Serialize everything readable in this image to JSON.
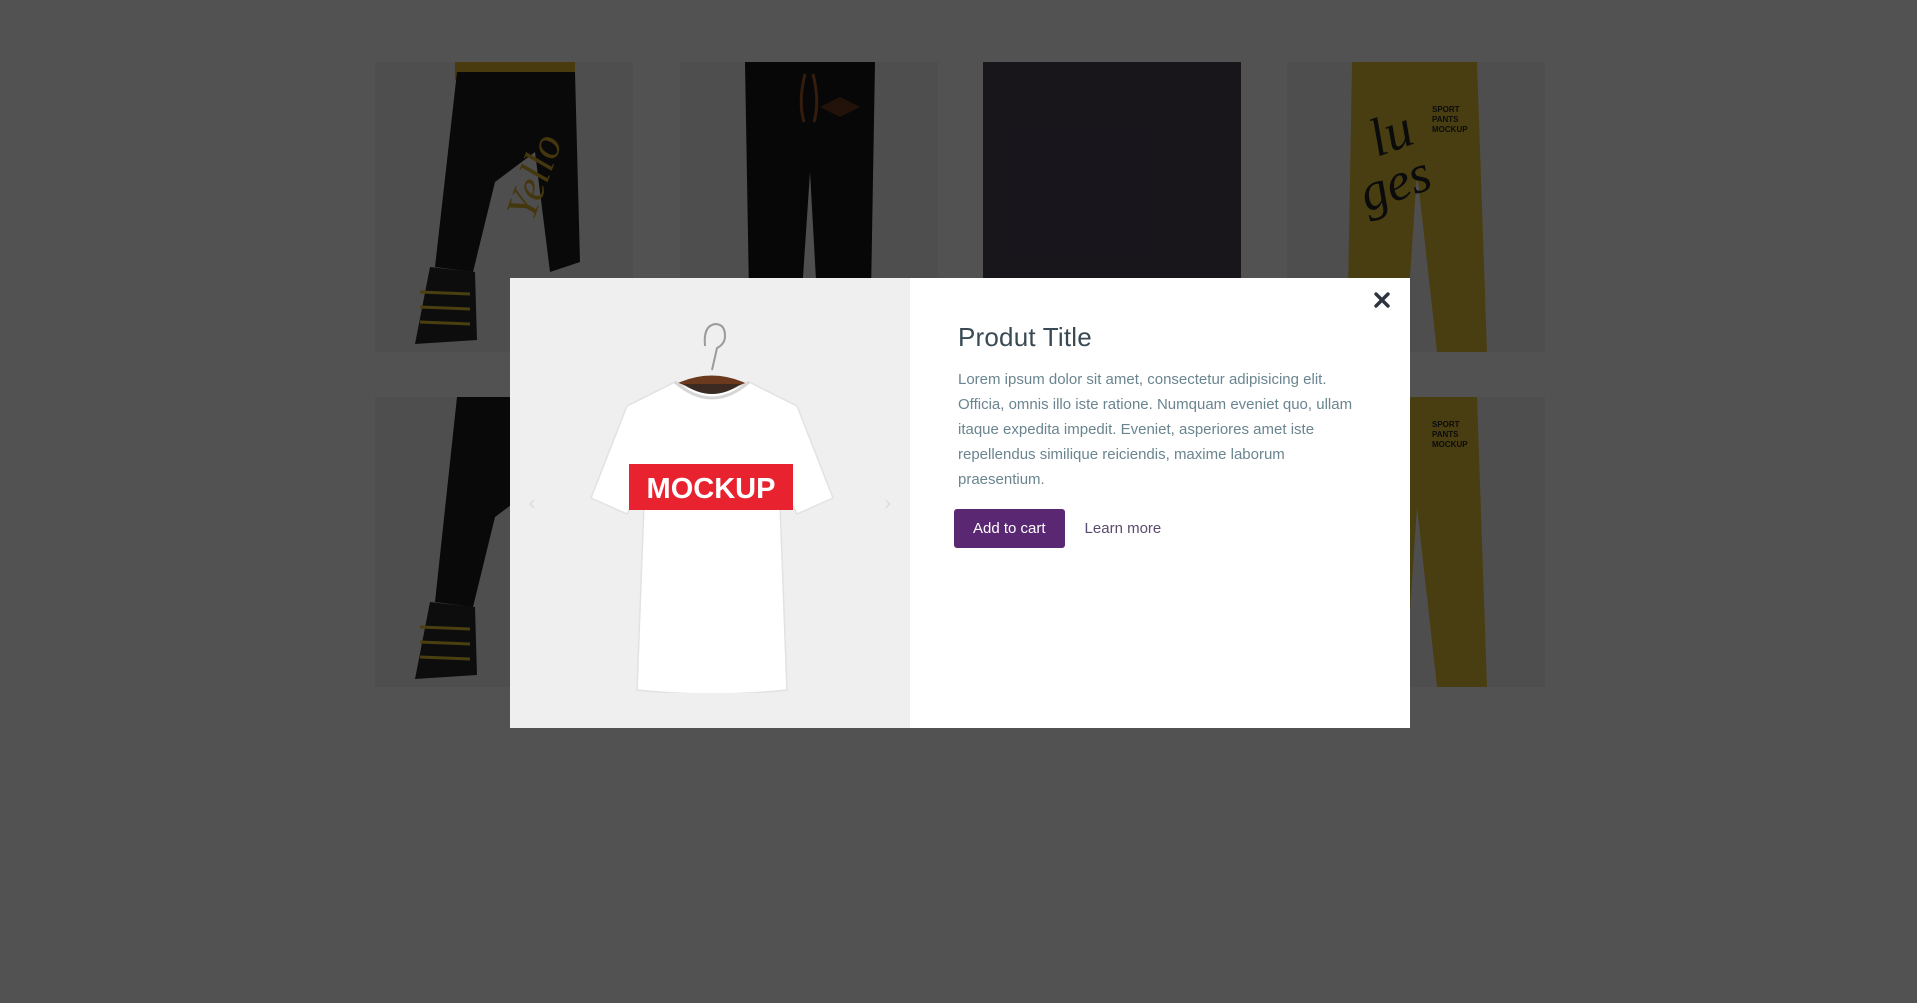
{
  "modal": {
    "title": "Produt Title",
    "description": "Lorem ipsum dolor sit amet, consectetur adipisicing elit. Officia, omnis illo iste ratione. Numquam eveniet quo, ullam itaque expedita impedit. Eveniet, asperiores amet iste repellendus similique reiciendis, maxime laborum praesentium.",
    "add_to_cart_label": "Add to cart",
    "learn_more_label": "Learn more",
    "product_image": {
      "icon": "tshirt-mockup-image",
      "print_text": "MOCKUP"
    }
  },
  "grid": {
    "products": [
      {
        "kind": "black-jogger-pants",
        "print": "Yello Om"
      },
      {
        "kind": "black-sweatpants"
      },
      {
        "kind": "dark-placeholder"
      },
      {
        "kind": "yellow-sport-pants",
        "print": "Sport Pants Mockup"
      },
      {
        "kind": "black-jogger-pants"
      },
      {
        "kind": "black-sweatpants"
      },
      {
        "kind": "dark-placeholder"
      },
      {
        "kind": "yellow-sport-pants"
      }
    ]
  },
  "colors": {
    "overlay": "rgba(0,0,0,0.68)",
    "primary_button": "#5a2773",
    "title": "#3a4a55",
    "text": "#6a8590",
    "tshirt_print": "#e8232f"
  }
}
